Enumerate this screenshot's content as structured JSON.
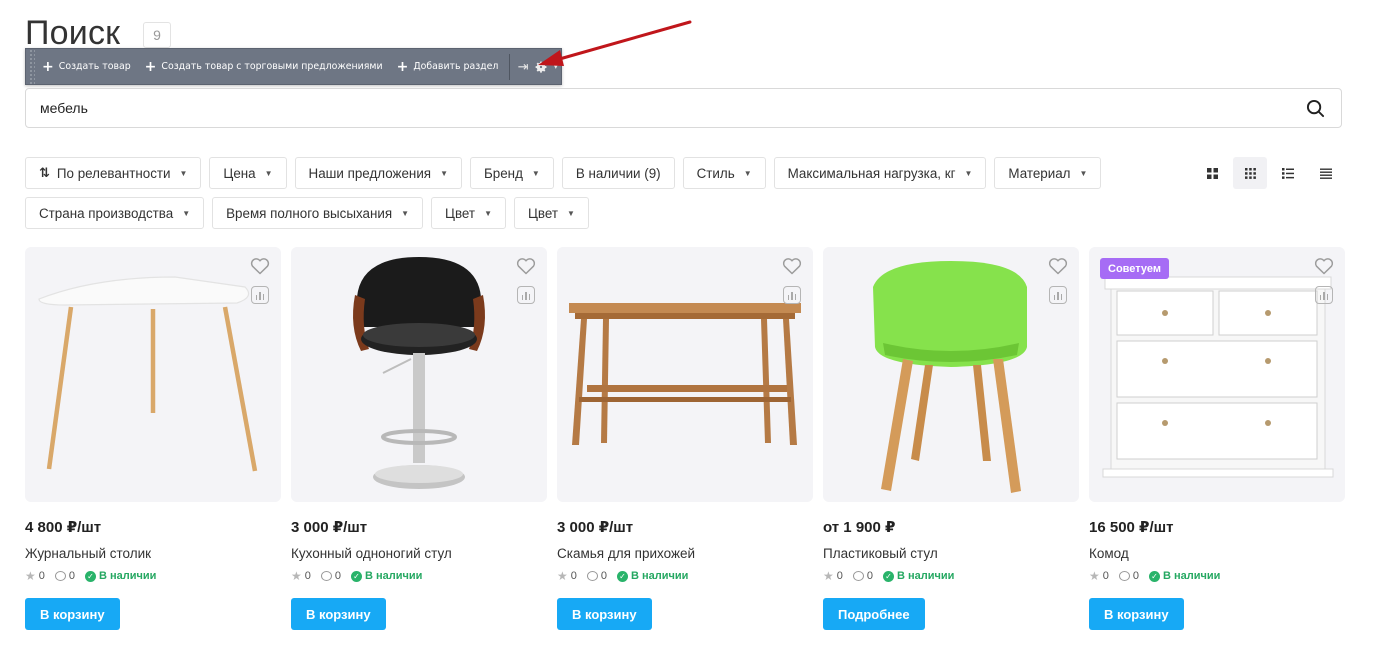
{
  "page": {
    "title": "Поиск",
    "count": "9"
  },
  "admin_toolbar": {
    "buttons": [
      "Создать товар",
      "Создать товар с торговыми предложениями",
      "Добавить раздел"
    ],
    "icons": [
      "pin-icon",
      "gear-icon",
      "chevron-down-icon"
    ],
    "annotation_color": "#c0161b"
  },
  "search": {
    "value": "мебель",
    "placeholder": ""
  },
  "filters": {
    "sort": "По релевантности",
    "items": [
      "Цена",
      "Наши предложения",
      "Бренд",
      "В наличии (9)",
      "Стиль",
      "Максимальная нагрузка, кг",
      "Материал",
      "Страна производства",
      "Время полного высыхания",
      "Цвет",
      "Цвет"
    ]
  },
  "view_modes": [
    "tile-large-icon",
    "tile-small-icon",
    "list-icon",
    "table-icon"
  ],
  "colors": {
    "accent": "#17a9f5",
    "in_stock": "#26a862",
    "sticker": "#a66cf5",
    "card_bg": "#f4f4f7"
  },
  "products": [
    {
      "price": "4 800 ₽/шт",
      "name": "Журнальный столик",
      "rating": "0",
      "comments": "0",
      "stock": "В наличии",
      "button": "В корзину",
      "sticker": ""
    },
    {
      "price": "3 000 ₽/шт",
      "name": "Кухонный одноногий стул",
      "rating": "0",
      "comments": "0",
      "stock": "В наличии",
      "button": "В корзину",
      "sticker": ""
    },
    {
      "price": "3 000 ₽/шт",
      "name": "Скамья для прихожей",
      "rating": "0",
      "comments": "0",
      "stock": "В наличии",
      "button": "В корзину",
      "sticker": ""
    },
    {
      "price": "от 1 900 ₽",
      "name": "Пластиковый стул",
      "rating": "0",
      "comments": "0",
      "stock": "В наличии",
      "button": "Подробнее",
      "sticker": ""
    },
    {
      "price": "16 500 ₽/шт",
      "name": "Комод",
      "rating": "0",
      "comments": "0",
      "stock": "В наличии",
      "button": "В корзину",
      "sticker": "Советуем"
    }
  ]
}
